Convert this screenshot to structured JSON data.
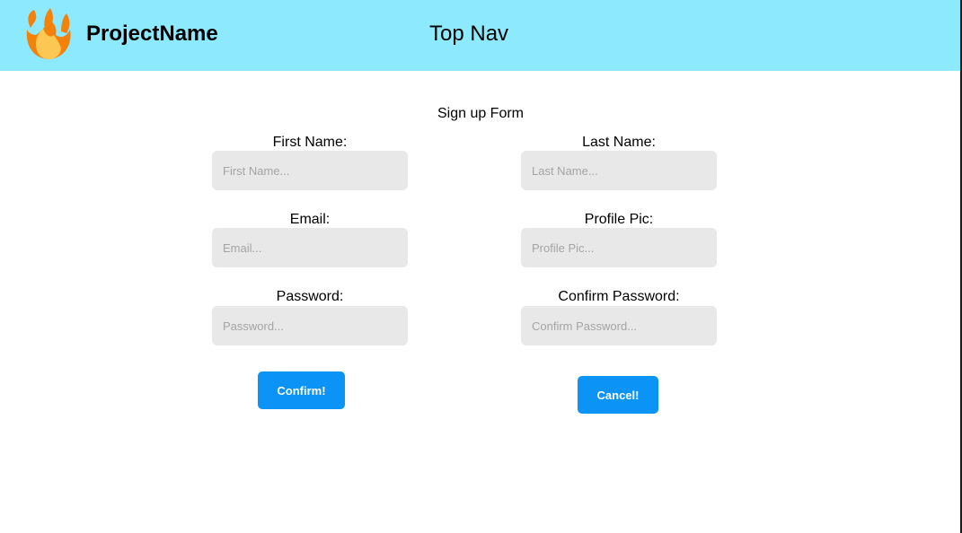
{
  "topnav": {
    "brand_name": "ProjectName",
    "title": "Top Nav",
    "logo_icon": "fire-icon",
    "background": "#8de9fd"
  },
  "form": {
    "title": "Sign up Form",
    "fields": {
      "first_name": {
        "label": "First Name:",
        "placeholder": "First Name..."
      },
      "last_name": {
        "label": "Last Name:",
        "placeholder": "Last Name..."
      },
      "email": {
        "label": "Email:",
        "placeholder": "Email..."
      },
      "profile_pic": {
        "label": "Profile Pic:",
        "placeholder": "Profile Pic..."
      },
      "password": {
        "label": "Password:",
        "placeholder": "Password..."
      },
      "confirm_password": {
        "label": "Confirm Password:",
        "placeholder": "Confirm Password..."
      }
    },
    "confirm_label": "Confirm!",
    "cancel_label": "Cancel!",
    "button_color": "#0b93f6",
    "input_background": "#e8e8e8"
  }
}
